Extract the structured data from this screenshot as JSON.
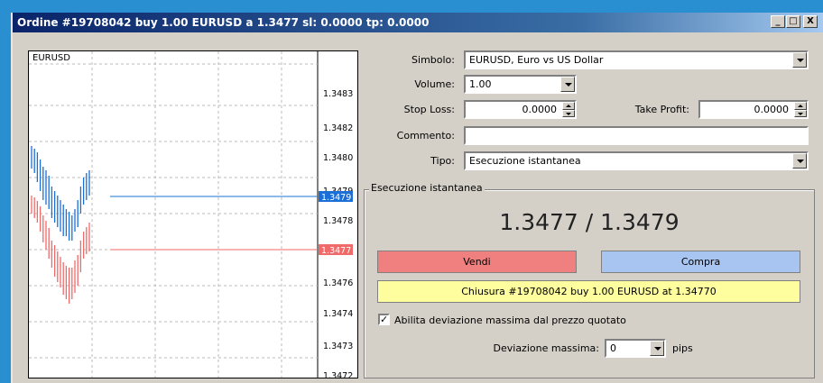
{
  "window": {
    "title": "Ordine #19708042 buy 1.00 EURUSD a 1.3477 sl: 0.0000 tp: 0.0000",
    "minimize": "_",
    "maximize": "□",
    "close": "X"
  },
  "chart": {
    "symbol": "EURUSD",
    "price_levels": [
      "1.3483",
      "1.3482",
      "1.3480",
      "1.3479",
      "1.3478",
      "1.3477",
      "1.3476",
      "1.3474",
      "1.3473",
      "1.3472"
    ],
    "ask_marker": "1.3479",
    "bid_marker": "1.3477",
    "ask_color": "#1c6fd6",
    "bid_color": "#f06a6a"
  },
  "form": {
    "symbol_label": "Simbolo:",
    "symbol_value": "EURUSD, Euro vs US Dollar",
    "volume_label": "Volume:",
    "volume_value": "1.00",
    "stoploss_label": "Stop Loss:",
    "stoploss_value": "0.0000",
    "takeprofit_label": "Take Profit:",
    "takeprofit_value": "0.0000",
    "comment_label": "Commento:",
    "comment_value": "",
    "type_label": "Tipo:",
    "type_value": "Esecuzione istantanea"
  },
  "execution": {
    "group_title": "Esecuzione istantanea",
    "quote": "1.3477 / 1.3479",
    "sell_label": "Vendi",
    "buy_label": "Compra",
    "close_label": "Chiusura #19708042 buy 1.00 EURUSD at 1.34770",
    "checkbox_label": "Abilita deviazione massima dal prezzo quotato",
    "checkbox_checked": true,
    "checkbox_mark": "✓",
    "deviation_label": "Deviazione massima:",
    "deviation_value": "0",
    "deviation_unit": "pips",
    "sell_color": "#f08080",
    "buy_color": "#a8c4f0",
    "close_color": "#fefe9e"
  }
}
